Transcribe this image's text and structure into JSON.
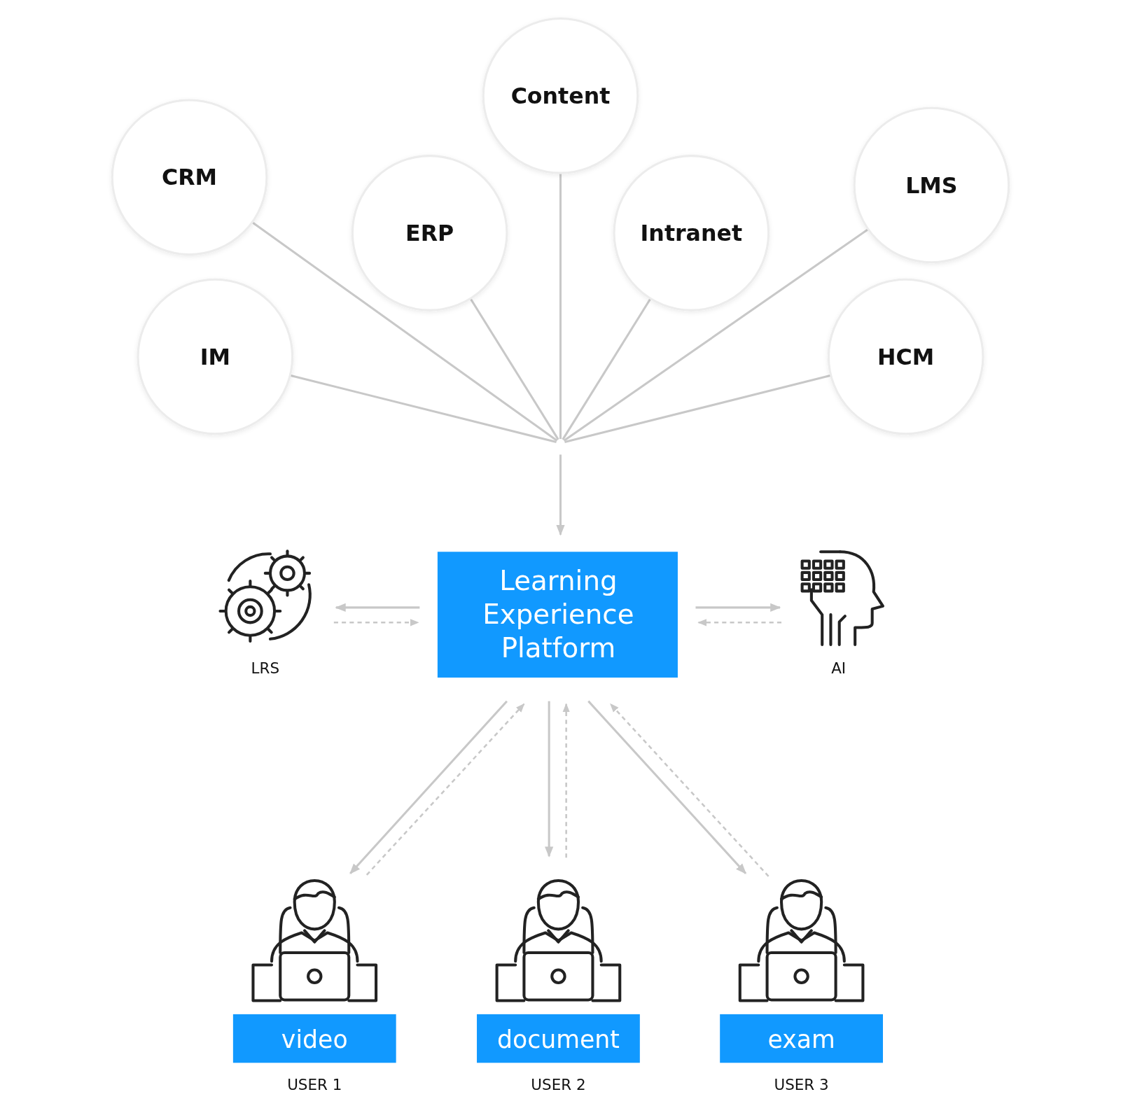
{
  "sources": [
    {
      "label": "Content"
    },
    {
      "label": "CRM"
    },
    {
      "label": "ERP"
    },
    {
      "label": "Intranet"
    },
    {
      "label": "LMS"
    },
    {
      "label": "IM"
    },
    {
      "label": "HCM"
    }
  ],
  "platform": {
    "title": "Learning Experience Platform"
  },
  "services": [
    {
      "label": "LRS",
      "kind": "gears"
    },
    {
      "label": "AI",
      "kind": "head"
    }
  ],
  "users": [
    {
      "content": "video",
      "user": "USER 1"
    },
    {
      "content": "document",
      "user": "USER 2"
    },
    {
      "content": "exam",
      "user": "USER 3"
    }
  ]
}
